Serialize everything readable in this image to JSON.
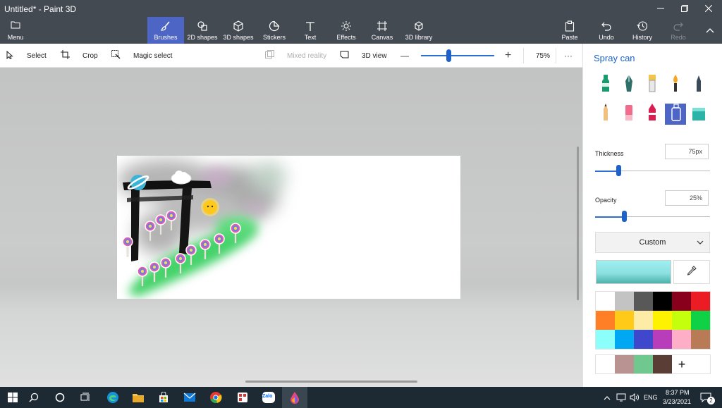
{
  "window": {
    "title": "Untitled* - Paint 3D",
    "min_icon": "minimize-icon",
    "max_icon": "maximize-icon",
    "close_icon": "close-icon"
  },
  "menu": {
    "label": "Menu",
    "icon": "folder-icon"
  },
  "toolbar": {
    "tools": [
      {
        "label": "Brushes",
        "icon": "brush-icon",
        "active": true
      },
      {
        "label": "2D shapes",
        "icon": "2d-shapes-icon"
      },
      {
        "label": "3D shapes",
        "icon": "cube-icon"
      },
      {
        "label": "Stickers",
        "icon": "sticker-icon"
      },
      {
        "label": "Text",
        "icon": "text-icon"
      },
      {
        "label": "Effects",
        "icon": "effects-icon"
      },
      {
        "label": "Canvas",
        "icon": "canvas-icon"
      },
      {
        "label": "3D library",
        "icon": "3d-library-icon"
      }
    ],
    "paste": "Paste",
    "undo": "Undo",
    "history": "History",
    "redo": "Redo"
  },
  "subbar": {
    "select": "Select",
    "crop": "Crop",
    "magic_select": "Magic select",
    "mixed_reality": "Mixed reality",
    "view_3d": "3D view",
    "zoom_minus": "—",
    "zoom_plus": "+",
    "zoom_value": "75%",
    "more": "···"
  },
  "zoom": {
    "level_percent": 75
  },
  "panel": {
    "title": "Spray can",
    "brushes": [
      "marker-icon",
      "calligraphy-pen-icon",
      "oil-brush-icon",
      "watercolor-icon",
      "pixel-pen-icon",
      "pencil-icon",
      "eraser-icon",
      "crayon-icon",
      "spray-can-icon",
      "fill-icon"
    ],
    "selected_brush": 8,
    "thickness_label": "Thickness",
    "thickness_value": "75px",
    "thickness_fraction": 0.2,
    "opacity_label": "Opacity",
    "opacity_value": "25%",
    "opacity_fraction": 0.25,
    "color_mode": "Custom",
    "current_color": "#8ce0e0",
    "palette": [
      "#ffffff",
      "#c3c3c3",
      "#585858",
      "#000000",
      "#88001b",
      "#ec1c24",
      "#ff7f27",
      "#ffca18",
      "#fdeca6",
      "#fff200",
      "#c4ff0e",
      "#0ed145",
      "#8cfffb",
      "#00a8f3",
      "#3f48cc",
      "#b83dba",
      "#ffaec8",
      "#b97a56"
    ],
    "custom_colors": [
      "#ffffff",
      "#b99292",
      "#6fc98f",
      "#5a3e36"
    ],
    "add_color": "+"
  },
  "taskbar": {
    "icons": [
      "windows-start-icon",
      "search-icon",
      "cortana-icon",
      "task-view-icon",
      "edge-icon",
      "file-explorer-icon",
      "store-icon",
      "mail-icon",
      "chrome-icon",
      "app-icon",
      "zalo-icon",
      "paint3d-icon"
    ],
    "zalo_text": "Zalo",
    "language": "ENG",
    "time": "8:37 PM",
    "date": "3/23/2021",
    "notification_count": "2"
  }
}
